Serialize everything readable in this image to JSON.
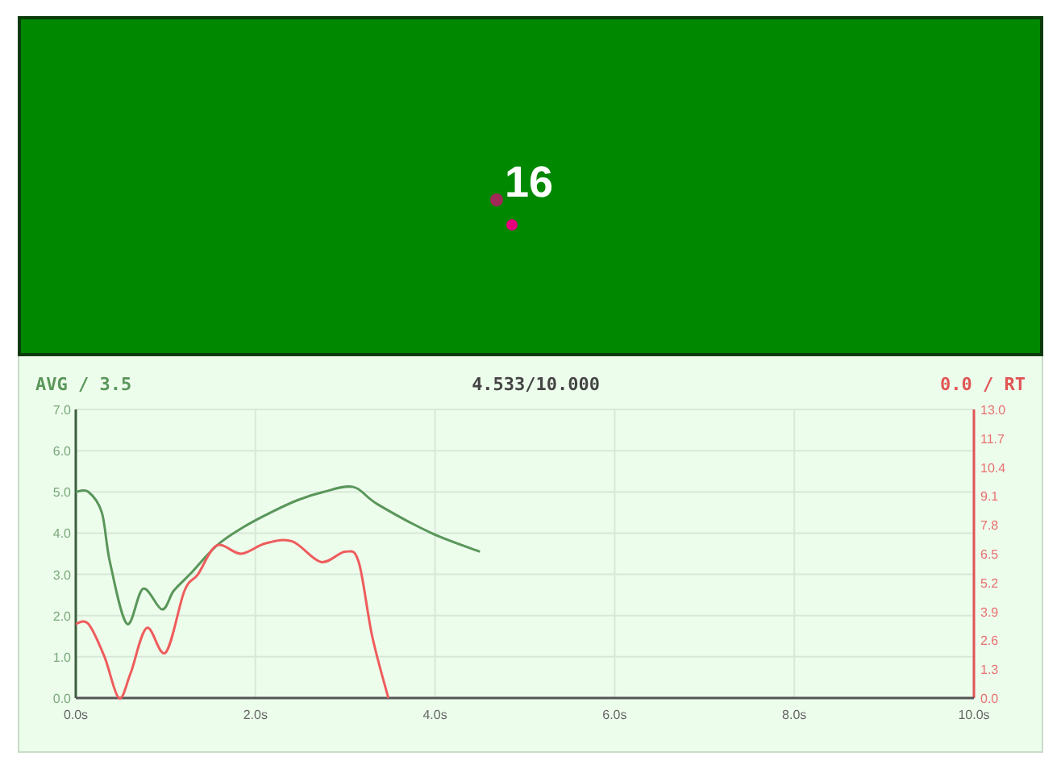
{
  "display": {
    "value": "16"
  },
  "stats": {
    "avg": "AVG / 3.5",
    "progress": "4.533/10.000",
    "rt": "0.0 / RT"
  },
  "chart": {
    "chart_data": {
      "type": "line",
      "xlim": [
        0,
        10
      ],
      "ylim": [
        0,
        7
      ],
      "y2lim": [
        0,
        13
      ],
      "grid": true,
      "xticks": [
        {
          "value": 0,
          "label": "0.0s"
        },
        {
          "value": 2,
          "label": "2.0s"
        },
        {
          "value": 4,
          "label": "4.0s"
        },
        {
          "value": 6,
          "label": "6.0s"
        },
        {
          "value": 8,
          "label": "8.0s"
        },
        {
          "value": 10,
          "label": "10.0s"
        }
      ],
      "yticks": [
        {
          "value": 0,
          "label": "0.0"
        },
        {
          "value": 1,
          "label": "1.0"
        },
        {
          "value": 2,
          "label": "2.0"
        },
        {
          "value": 3,
          "label": "3.0"
        },
        {
          "value": 4,
          "label": "4.0"
        },
        {
          "value": 5,
          "label": "5.0"
        },
        {
          "value": 6,
          "label": "6.0"
        },
        {
          "value": 7,
          "label": "7.0"
        }
      ],
      "y2ticks": [
        {
          "value": 0,
          "label": "0.0"
        },
        {
          "value": 1.3,
          "label": "1.3"
        },
        {
          "value": 2.6,
          "label": "2.6"
        },
        {
          "value": 3.9,
          "label": "3.9"
        },
        {
          "value": 5.2,
          "label": "5.2"
        },
        {
          "value": 6.5,
          "label": "6.5"
        },
        {
          "value": 7.8,
          "label": "7.8"
        },
        {
          "value": 9.1,
          "label": "9.1"
        },
        {
          "value": 10.4,
          "label": "10.4"
        },
        {
          "value": 11.7,
          "label": "11.7"
        },
        {
          "value": 13,
          "label": "13.0"
        }
      ],
      "series": [
        {
          "color": "#5a965a",
          "x": [
            0,
            0.14,
            0.29,
            0.38,
            0.57,
            0.75,
            0.96,
            1.09,
            1.27,
            1.57,
            1.87,
            2.17,
            2.47,
            2.76,
            3.09,
            3.36,
            3.96,
            4.5
          ],
          "values": [
            5.0,
            5.0,
            4.5,
            3.3,
            1.8,
            2.65,
            2.15,
            2.6,
            3.0,
            3.7,
            4.15,
            4.5,
            4.8,
            5.0,
            5.12,
            4.7,
            4.0,
            3.55
          ]
        },
        {
          "color": "#ee5c5c",
          "x": [
            0,
            0.14,
            0.32,
            0.48,
            0.61,
            0.79,
            1.0,
            1.21,
            1.36,
            1.57,
            1.84,
            2.11,
            2.41,
            2.73,
            3.0,
            3.15,
            3.3,
            3.48
          ],
          "values": [
            1.8,
            1.8,
            1.0,
            0,
            0.6,
            1.7,
            1.1,
            2.6,
            3.0,
            3.7,
            3.5,
            3.75,
            3.8,
            3.3,
            3.55,
            3.3,
            1.5,
            0
          ]
        }
      ]
    }
  }
}
